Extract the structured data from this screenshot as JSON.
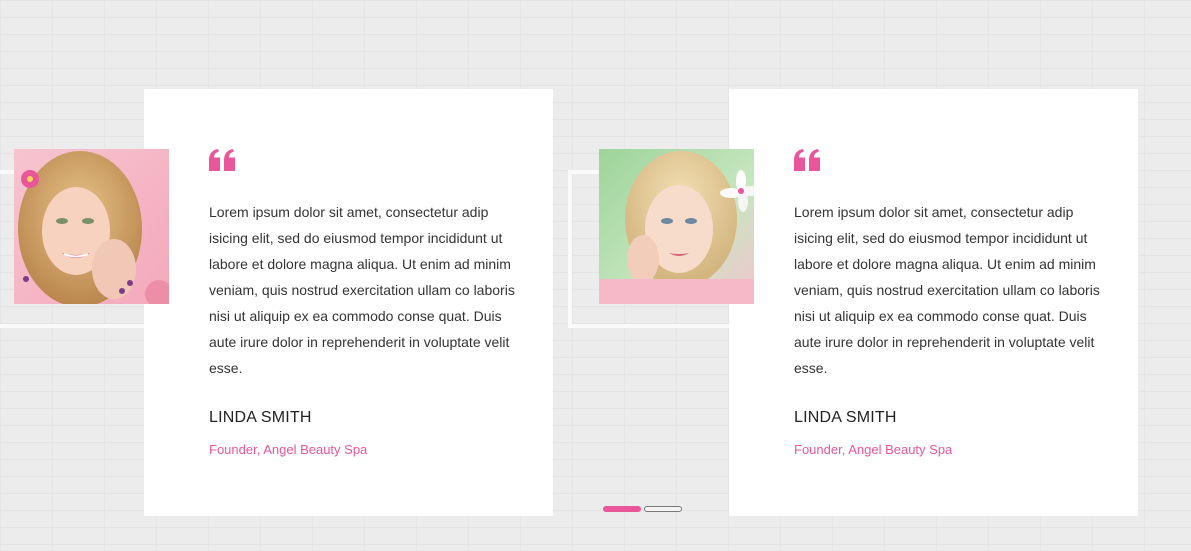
{
  "testimonials": [
    {
      "quote": "Lorem ipsum dolor sit amet, consectetur adip isicing elit, sed do eiusmod tempor incididunt ut labore et dolore magna aliqua. Ut enim ad minim veniam, quis nostrud exercitation ullam co laboris nisi ut aliquip ex ea commodo conse quat. Duis aute irure dolor in reprehenderit in voluptate velit esse.",
      "name": "LINDA SMITH",
      "role": "Founder, Angel Beauty Spa",
      "photo_icon": "woman-portrait-curly-blonde"
    },
    {
      "quote": "Lorem ipsum dolor sit amet, consectetur adip isicing elit, sed do eiusmod tempor incididunt ut labore et dolore magna aliqua. Ut enim ad minim veniam, quis nostrud exercitation ullam co laboris nisi ut aliquip ex ea commodo conse quat. Duis aute irure dolor in reprehenderit in voluptate velit esse.",
      "name": "LINDA SMITH",
      "role": "Founder, Angel Beauty Spa",
      "photo_icon": "woman-portrait-flower"
    }
  ],
  "pager": {
    "pages": 2,
    "active_page": 1
  },
  "colors": {
    "accent": "#e9579a",
    "card_background": "#ffffff",
    "page_background": "#ececec",
    "body_text": "#333333"
  },
  "icons": {
    "quote": "quote-left-icon"
  }
}
